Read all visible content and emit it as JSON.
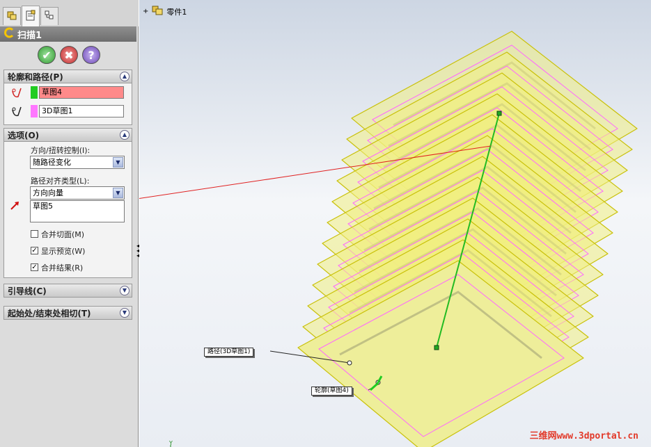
{
  "property_manager": {
    "feature_title": "扫描1",
    "tabs": [
      "feature-manager",
      "property-manager",
      "configuration-manager"
    ],
    "section_profile_path": {
      "title": "轮廓和路径(P)",
      "profile_value": "草图4",
      "path_value": "3D草图1",
      "profile_color": "#22cc22",
      "path_color": "#ff77ff"
    },
    "section_options": {
      "title": "选项(O)",
      "orientation_label": "方向/扭转控制(I):",
      "orientation_value": "随路径变化",
      "path_align_label": "路径对齐类型(L):",
      "path_align_value": "方向向量",
      "direction_vector_value": "草图5",
      "merge_tangent_faces": "合并切面(M)",
      "show_preview": "显示预览(W)",
      "merge_result": "合并结果(R)",
      "merge_tangent_checked": false,
      "show_preview_checked": true,
      "merge_result_checked": true
    },
    "section_guide_curves": {
      "title": "引导线(C)"
    },
    "section_start_end_tangency": {
      "title": "起始处/结束处相切(T)"
    }
  },
  "viewport": {
    "tree_root": "零件1",
    "path_callout": "路径(3D草图1)",
    "profile_callout": "轮廓(草图4)",
    "axis_label": "Y",
    "watermark": "三维网www.3dportal.cn"
  },
  "colors": {
    "accent_yellow": "#f7f56a",
    "path_magenta": "#ff66ff",
    "direction_green": "#22bb22",
    "annotation_red": "#e02020"
  }
}
